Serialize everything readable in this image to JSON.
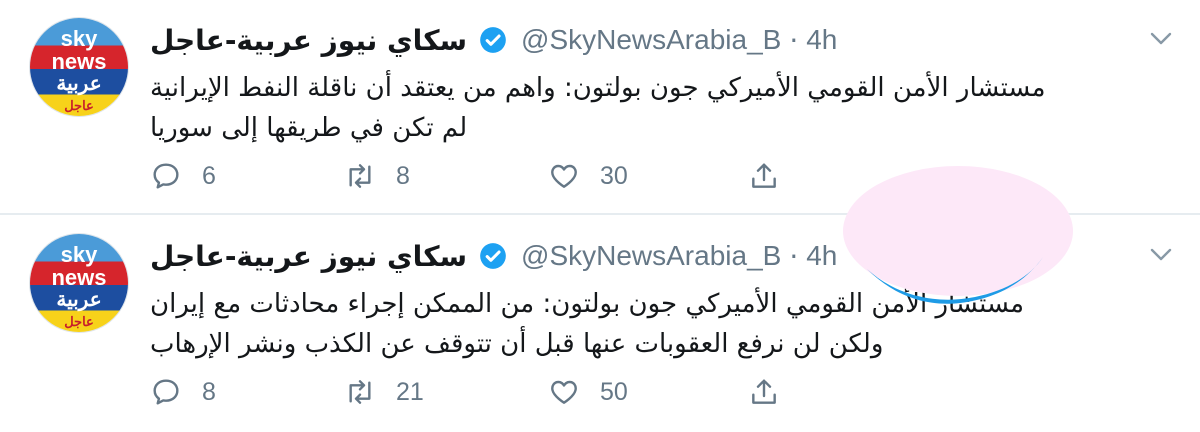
{
  "tweets": [
    {
      "avatar": {
        "line1": "sky",
        "line2": "news",
        "line3": "عربية",
        "line4": "عاجل"
      },
      "display_name": "سكاي نيوز عربية-عاجل",
      "handle": "@SkyNewsArabia_B",
      "separator": "·",
      "time": "4h",
      "text_lines": [
        "مستشار الأمن القومي الأميركي جون بولتون: واهم من يعتقد أن ناقلة النفط الإيرانية",
        "لم تكن في طريقها إلى سوريا"
      ],
      "replies": "6",
      "retweets": "8",
      "likes": "30"
    },
    {
      "avatar": {
        "line1": "sky",
        "line2": "news",
        "line3": "عربية",
        "line4": "عاجل"
      },
      "display_name": "سكاي نيوز عربية-عاجل",
      "handle": "@SkyNewsArabia_B",
      "separator": "·",
      "time": "4h",
      "text_lines": [
        "مستشار الأمن القومي الأميركي جون بولتون: من الممكن إجراء محادثات مع إيران",
        "ولكن لن نرفع العقوبات عنها قبل أن تتوقف عن الكذب ونشر الإرهاب"
      ],
      "replies": "8",
      "retweets": "21",
      "likes": "50"
    }
  ],
  "icons": {
    "verified": "verified-badge-icon",
    "reply": "reply-bubble-icon",
    "retweet": "retweet-arrows-icon",
    "like": "heart-icon",
    "share": "share-upload-icon",
    "more": "chevron-down-icon"
  },
  "colors": {
    "text": "#14171a",
    "muted": "#657786",
    "verified": "#1da1f2",
    "divider": "#e6ecf0"
  }
}
